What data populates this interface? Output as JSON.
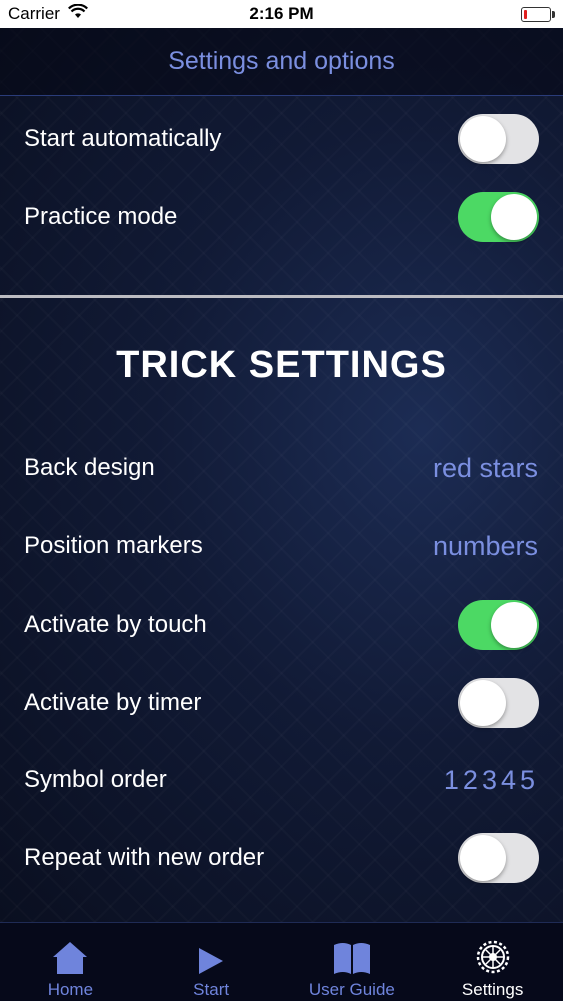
{
  "status_bar": {
    "carrier": "Carrier",
    "time": "2:16 PM",
    "battery_color": "#e0201f",
    "battery_level": 0.12
  },
  "header": {
    "title": "Settings and options"
  },
  "general": {
    "start_automatically": {
      "label": "Start automatically",
      "on": false
    },
    "practice_mode": {
      "label": "Practice mode",
      "on": true
    }
  },
  "trick": {
    "heading": "TRICK SETTINGS",
    "back_design": {
      "label": "Back design",
      "value": "red stars"
    },
    "position_markers": {
      "label": "Position markers",
      "value": "numbers"
    },
    "activate_by_touch": {
      "label": "Activate by touch",
      "on": true
    },
    "activate_by_timer": {
      "label": "Activate by timer",
      "on": false
    },
    "symbol_order": {
      "label": "Symbol order",
      "value": "12345"
    },
    "repeat_new_order": {
      "label": "Repeat with new order",
      "on": false
    }
  },
  "tabs": [
    {
      "label": "Home",
      "icon": "home-icon"
    },
    {
      "label": "Start",
      "icon": "play-icon"
    },
    {
      "label": "User Guide",
      "icon": "book-icon"
    },
    {
      "label": "Settings",
      "icon": "gear-icon",
      "active": true
    }
  ],
  "colors": {
    "accent": "#7b8fe0",
    "toggle_on": "#4cd964",
    "toggle_off": "#e3e3e5"
  }
}
